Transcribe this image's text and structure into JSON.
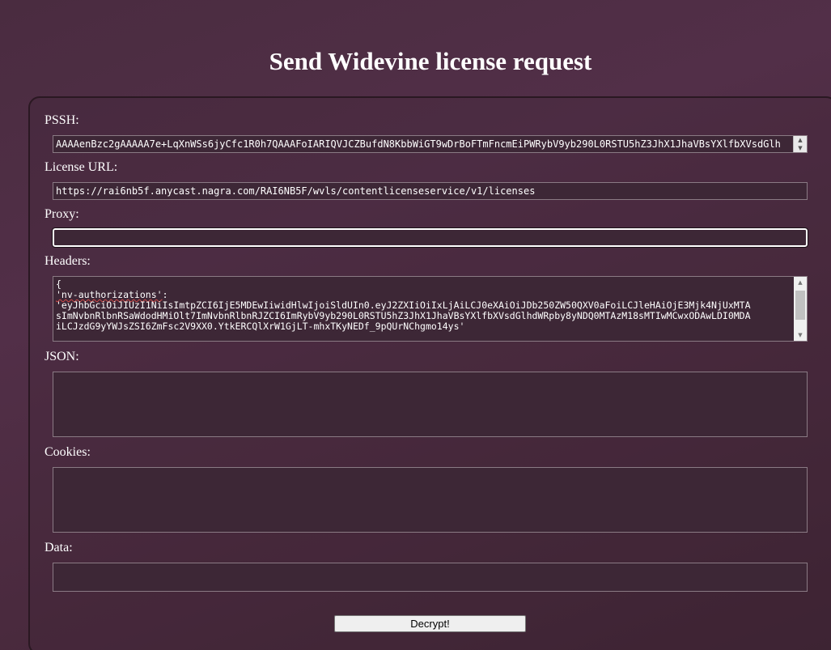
{
  "page": {
    "title": "Send Widevine license request"
  },
  "form": {
    "pssh": {
      "label": "PSSH:",
      "value": "AAAAenBzc2gAAAAA7e+LqXnWSs6jyCfc1R0h7QAAAFoIARIQVJCZBufdN8KbbWiGT9wDrBoFTmFncmEiPWRybV9yb290L0RSTU5hZ3JhX1JhaVBsYXlfbXVsdGlh"
    },
    "license_url": {
      "label": "License URL:",
      "value": "https://rai6nb5f.anycast.nagra.com/RAI6NB5F/wvls/contentlicenseservice/v1/licenses"
    },
    "proxy": {
      "label": "Proxy:",
      "value": ""
    },
    "headers": {
      "label": "Headers:",
      "line1": "{",
      "line2_key": "'nv-authorizations'",
      "line2_rest": ":",
      "line3": "'eyJhbGciOiJIUzI1NiIsImtpZCI6IjE5MDEwIiwidHlwIjoiSldUIn0.eyJ2ZXIiOiIxLjAiLCJ0eXAiOiJDb250ZW50QXV0aFoiLCJleHAiOjE3Mjk4NjUxMTA",
      "line4": "sImNvbnRlbnRSaWdodHMiOlt7ImNvbnRlbnRJZCI6ImRybV9yb290L0RSTU5hZ3JhX1JhaVBsYXlfbXVsdGlhdWRpby8yNDQ0MTAzM18sMTIwMCwxODAwLDI0MDA",
      "line5": "iLCJzdG9yYWJsZSI6ZmFsc2V9XX0.YtkERCQlXrW1GjLT-mhxTKyNEDf_9pQUrNChgmo14ys'"
    },
    "json": {
      "label": "JSON:",
      "value": ""
    },
    "cookies": {
      "label": "Cookies:",
      "value": ""
    },
    "data": {
      "label": "Data:",
      "value": ""
    },
    "submit_label": "Decrypt!"
  },
  "icons": {
    "spinner_up": "▲",
    "spinner_down": "▼",
    "scroll_up": "▲",
    "scroll_down": "▼"
  },
  "colors": {
    "background": "#4a2c40",
    "text": "#ffffff",
    "field_bg": "#3d2736",
    "button_bg": "#efefef"
  }
}
